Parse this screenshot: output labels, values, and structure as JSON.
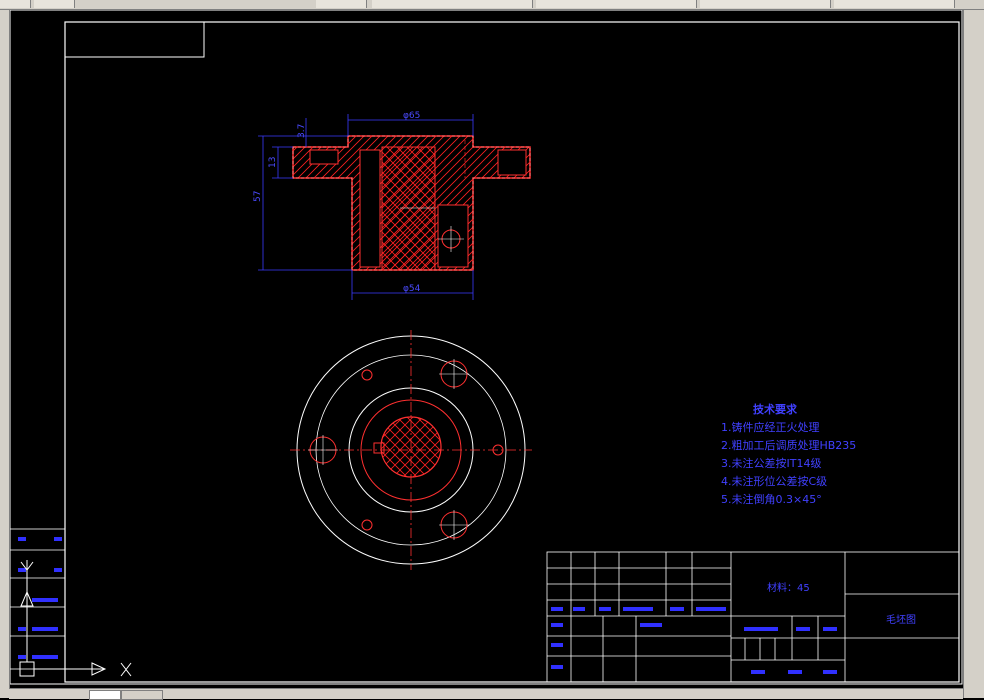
{
  "drawing": {
    "dim_top": "φ65",
    "dim_bottom": "φ54",
    "dim_height": "57",
    "dim_flange": "13",
    "dim_small": "3.7"
  },
  "tech": {
    "title": "技术要求",
    "items": [
      "1.铸件应经正火处理",
      "2.粗加工后调质处理HB235",
      "3.未注公差按IT14级",
      "4.未注形位公差按C级",
      "5.未注倒角0.3×45°"
    ]
  },
  "titleblock": {
    "material": "材料：45",
    "part_name": "毛坯图"
  },
  "colors": {
    "section_red": "#ff0000",
    "dim_blue": "#3a3aff",
    "text_blue": "#4040ff",
    "frame_white": "#ffffff"
  }
}
